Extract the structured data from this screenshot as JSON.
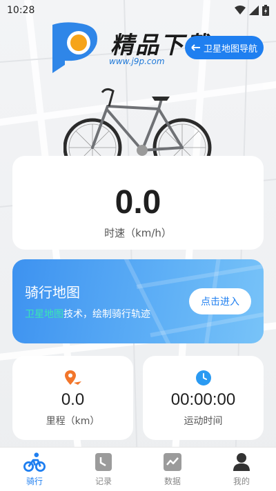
{
  "status_bar": {
    "time": "10:28"
  },
  "watermark": {
    "title": "精品下载",
    "url": "www.j9p.com"
  },
  "header": {
    "nav_button_label": "卫星地图导航"
  },
  "speed": {
    "value": "0.0",
    "label": "时速（km/h）"
  },
  "map_card": {
    "title": "骑行地图",
    "desc_highlight": "卫星地图",
    "desc_rest": "技术，绘制骑行轨迹",
    "enter_label": "点击进入"
  },
  "stats": {
    "distance": {
      "value": "0.0",
      "label": "里程（km）",
      "icon": "location-bike-icon"
    },
    "duration": {
      "value": "00:00:00",
      "label": "运动时间",
      "icon": "clock-icon"
    }
  },
  "tabs": [
    {
      "label": "骑行",
      "icon": "cyclist-icon",
      "active": true
    },
    {
      "label": "记录",
      "icon": "record-icon",
      "active": false
    },
    {
      "label": "数据",
      "icon": "chart-icon",
      "active": false
    },
    {
      "label": "我的",
      "icon": "profile-icon",
      "active": false
    }
  ],
  "colors": {
    "accent": "#1f7ff0",
    "highlight": "#39e7b3",
    "distance_icon": "#f2762b",
    "clock_icon": "#2a9af2"
  }
}
